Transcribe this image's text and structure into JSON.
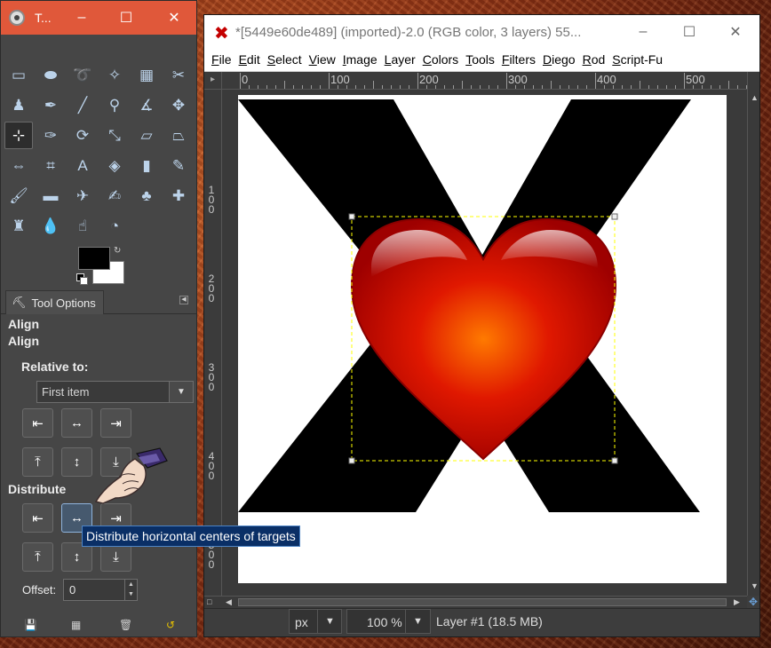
{
  "desktop": {},
  "toolbox": {
    "title": "T...",
    "tools": [
      {
        "name": "rect-select-icon",
        "glyph": "▭"
      },
      {
        "name": "ellipse-select-icon",
        "glyph": "⬬"
      },
      {
        "name": "free-select-icon",
        "glyph": "➰"
      },
      {
        "name": "fuzzy-select-icon",
        "glyph": "✧"
      },
      {
        "name": "select-by-color-icon",
        "glyph": "▦"
      },
      {
        "name": "scissors-select-icon",
        "glyph": "✂"
      },
      {
        "name": "foreground-select-icon",
        "glyph": "♟"
      },
      {
        "name": "paths-icon",
        "glyph": "✒"
      },
      {
        "name": "color-picker-icon",
        "glyph": "╱"
      },
      {
        "name": "zoom-icon",
        "glyph": "⚲"
      },
      {
        "name": "measure-icon",
        "glyph": "∡"
      },
      {
        "name": "move-icon",
        "glyph": "✥"
      },
      {
        "name": "align-icon",
        "glyph": "⊹"
      },
      {
        "name": "crop-icon",
        "glyph": "✑"
      },
      {
        "name": "rotate-icon",
        "glyph": "⟳"
      },
      {
        "name": "scale-icon",
        "glyph": "⤡"
      },
      {
        "name": "shear-icon",
        "glyph": "▱"
      },
      {
        "name": "perspective-icon",
        "glyph": "⏢"
      },
      {
        "name": "flip-icon",
        "glyph": "⇔"
      },
      {
        "name": "cage-transform-icon",
        "glyph": "⌗"
      },
      {
        "name": "text-icon",
        "glyph": "A"
      },
      {
        "name": "bucket-fill-icon",
        "glyph": "◈"
      },
      {
        "name": "gradient-icon",
        "glyph": "▮"
      },
      {
        "name": "pencil-icon",
        "glyph": "✎"
      },
      {
        "name": "paintbrush-icon",
        "glyph": "🖌"
      },
      {
        "name": "eraser-icon",
        "glyph": "▬"
      },
      {
        "name": "airbrush-icon",
        "glyph": "✈"
      },
      {
        "name": "ink-icon",
        "glyph": "✍"
      },
      {
        "name": "clone-icon",
        "glyph": "♣"
      },
      {
        "name": "heal-icon",
        "glyph": "✚"
      },
      {
        "name": "perspective-clone-icon",
        "glyph": "♜"
      },
      {
        "name": "blur-icon",
        "glyph": "💧"
      },
      {
        "name": "smudge-icon",
        "glyph": "☝"
      },
      {
        "name": "dodge-burn-icon",
        "glyph": "◔"
      }
    ],
    "dock_tab_label": "Tool Options",
    "heading1": "Align",
    "heading2": "Align",
    "relative_to_label": "Relative to:",
    "relative_to_value": "First item",
    "distribute_label": "Distribute",
    "offset_label": "Offset:",
    "offset_value": "0",
    "tooltip": "Distribute horizontal centers of targets"
  },
  "image_window": {
    "title": "*[5449e60de489] (imported)-2.0 (RGB color, 3 layers) 55...",
    "menus": [
      "File",
      "Edit",
      "Select",
      "View",
      "Image",
      "Layer",
      "Colors",
      "Tools",
      "Filters",
      "Diego",
      "Rod",
      "Script-Fu"
    ],
    "menu_mnemonic_index": [
      0,
      0,
      0,
      0,
      0,
      0,
      0,
      0,
      0,
      0,
      0,
      0
    ],
    "h_ruler_labels": [
      "0",
      "100",
      "200",
      "300",
      "400",
      "500"
    ],
    "v_ruler_labels": [
      "1\n0\n0",
      "2\n0\n0",
      "3\n0\n0",
      "4\n0\n0",
      "5\n0\n0"
    ],
    "unit": "px",
    "zoom": "100 %",
    "layer_status": "Layer #1 (18.5 MB)"
  },
  "colors": {
    "titlebar_toolbox": "#e0583a",
    "heart_red": "#d40000",
    "heart_glow": "#ff7a00",
    "x_shape": "#000000",
    "selection_outline": "#ffff00"
  }
}
